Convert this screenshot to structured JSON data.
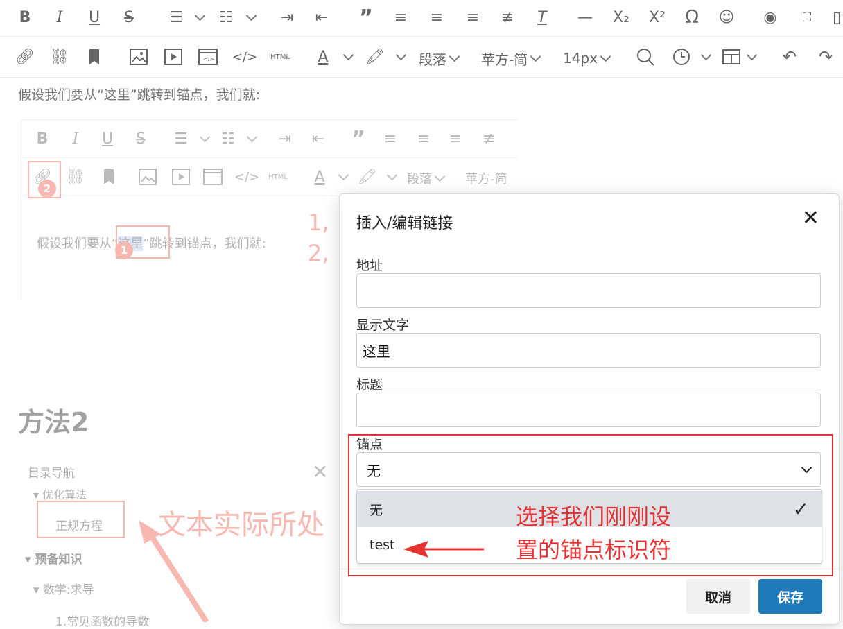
{
  "main_toolbar": {
    "block_format": "段落",
    "font_family": "苹方-简",
    "font_size": "14px",
    "html_label": "HTML"
  },
  "content": {
    "intro_line": "假设我们要从“这里”跳转到锚点，我们就:",
    "heading": "方法2"
  },
  "inner_editor": {
    "block_format": "段落",
    "font_family": "苹方-简",
    "html_label": "HTML",
    "intro_prefix": "假设我们要从“",
    "intro_highlight": "这里",
    "intro_suffix": "”跳转到锚点，我们就:",
    "step_markers": [
      "1,",
      "2,"
    ],
    "badge_1": "1",
    "badge_2": "2"
  },
  "toc": {
    "title": "目录导航",
    "items": [
      "优化算法",
      "正规方程",
      "预备知识",
      "数学:求导",
      "1.常见函数的导数"
    ],
    "annotation": "文本实际所处"
  },
  "dialog": {
    "title": "插入/编辑链接",
    "url_label": "地址",
    "url_value": "",
    "text_label": "显示文字",
    "text_value": "这里",
    "title_label": "标题",
    "title_value": "",
    "anchor_label": "锚点",
    "anchor_selected": "无",
    "anchor_options": [
      "无",
      "test"
    ],
    "annotation_line1": "选择我们刚刚设",
    "annotation_line2": "置的锚点标识符",
    "cancel_label": "取消",
    "save_label": "保存"
  },
  "colors": {
    "annotation_red": "#e53232",
    "save_blue": "#207ab7",
    "faded_red": "#f6b8b0"
  }
}
